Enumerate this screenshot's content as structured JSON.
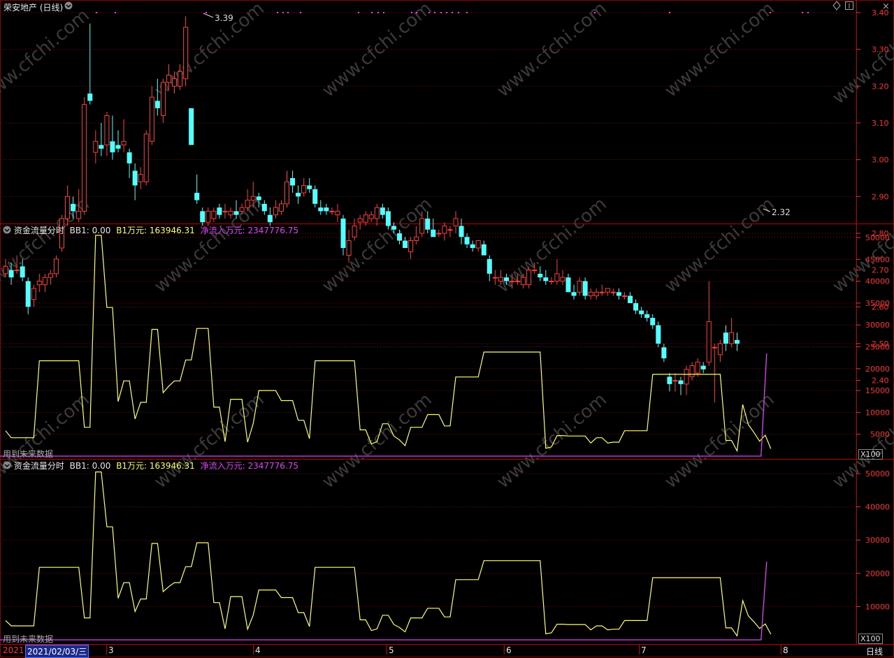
{
  "header": {
    "stock_title": "荣安地产 (日线)",
    "diamond_icon": "diamond-icon",
    "scroll_up_icon": "scroll-up-icon",
    "close_icon": "close-icon"
  },
  "price_panel": {
    "y_ticks": [
      "3.40",
      "3.30",
      "3.20",
      "3.10",
      "3.00",
      "2.90",
      "2.80",
      "2.70",
      "2.60",
      "2.50",
      "2.40"
    ],
    "high_label": "3.39",
    "low_label": "2.32",
    "watermark": "www.cfchi.com"
  },
  "indicator_panels": [
    {
      "title": "资金流量分时",
      "bb1_label": "BB1: 0.00",
      "b1_label": "B1万元: 163946.31",
      "net_label": "净流入万元: 2347776.75",
      "y_ticks": [
        "50000",
        "45000",
        "40000",
        "35000",
        "30000",
        "25000",
        "20000",
        "15000",
        "10000",
        "5000"
      ],
      "unit": "X100",
      "future_note": "用到未来数据"
    },
    {
      "title": "资金流量分时",
      "bb1_label": "BB1: 0.00",
      "b1_label": "B1万元: 163946.31",
      "net_label": "净流入万元: 2347776.75",
      "y_ticks": [
        "50000",
        "40000",
        "30000",
        "20000",
        "10000"
      ],
      "unit": "X100",
      "future_note": "用到未来数据"
    }
  ],
  "time_axis": {
    "year_label": "2021",
    "cursor_date": "2021/02/03/三",
    "month_labels": [
      "3",
      "4",
      "5",
      "6",
      "7",
      "8"
    ],
    "period_label": "日线"
  },
  "colors": {
    "up": "#ff3c3c",
    "down": "#54ffff",
    "grid": "#8b0000",
    "axis_text": "#ff3030",
    "b1_line": "#ffff66",
    "net_line": "#e040fb",
    "title_text": "#e8e8e8",
    "yellow_text": "#ffff66",
    "magenta_text": "#e040fb"
  },
  "chart_data": [
    {
      "type": "candlestick",
      "title": "荣安地产 (日线)",
      "ylim": [
        2.32,
        3.42
      ],
      "series": [
        {
          "ohlc": [
            [
              2.69,
              2.73,
              2.68,
              2.71
            ],
            [
              2.7,
              2.72,
              2.66,
              2.68
            ],
            [
              2.7,
              2.74,
              2.69,
              2.7
            ],
            [
              2.71,
              2.73,
              2.67,
              2.68
            ],
            [
              2.67,
              2.68,
              2.58,
              2.6
            ],
            [
              2.62,
              2.66,
              2.6,
              2.65
            ],
            [
              2.66,
              2.69,
              2.64,
              2.67
            ],
            [
              2.66,
              2.69,
              2.64,
              2.68
            ],
            [
              2.68,
              2.7,
              2.66,
              2.69
            ],
            [
              2.69,
              2.74,
              2.68,
              2.73
            ],
            [
              2.76,
              2.85,
              2.75,
              2.84
            ],
            [
              2.84,
              2.93,
              2.82,
              2.9
            ],
            [
              2.88,
              2.9,
              2.84,
              2.86
            ],
            [
              2.84,
              2.92,
              2.83,
              2.86
            ],
            [
              2.86,
              3.17,
              2.85,
              3.15
            ],
            [
              3.18,
              3.37,
              3.15,
              3.16
            ],
            [
              3.02,
              3.08,
              2.99,
              3.05
            ],
            [
              3.04,
              3.1,
              3.01,
              3.03
            ],
            [
              3.04,
              3.13,
              3.01,
              3.12
            ],
            [
              3.05,
              3.12,
              3.0,
              3.02
            ],
            [
              3.04,
              3.08,
              3.02,
              3.03
            ],
            [
              3.04,
              3.11,
              3.02,
              3.05
            ],
            [
              3.02,
              3.03,
              2.95,
              2.99
            ],
            [
              2.97,
              2.99,
              2.89,
              2.93
            ],
            [
              2.94,
              2.98,
              2.92,
              2.96
            ],
            [
              2.94,
              3.08,
              2.93,
              3.07
            ],
            [
              3.05,
              3.2,
              3.04,
              3.17
            ],
            [
              3.16,
              3.22,
              3.12,
              3.14
            ],
            [
              3.12,
              3.22,
              3.1,
              3.21
            ],
            [
              3.21,
              3.26,
              3.19,
              3.23
            ],
            [
              3.2,
              3.24,
              3.18,
              3.22
            ],
            [
              3.2,
              3.26,
              3.19,
              3.24
            ],
            [
              3.22,
              3.39,
              3.2,
              3.36
            ],
            [
              3.14,
              3.14,
              3.04,
              3.04
            ],
            [
              2.91,
              2.96,
              2.88,
              2.89
            ],
            [
              2.86,
              2.87,
              2.82,
              2.83
            ],
            [
              2.83,
              2.87,
              2.82,
              2.86
            ],
            [
              2.84,
              2.87,
              2.83,
              2.86
            ],
            [
              2.87,
              2.88,
              2.84,
              2.85
            ],
            [
              2.86,
              2.88,
              2.84,
              2.86
            ],
            [
              2.85,
              2.87,
              2.84,
              2.86
            ],
            [
              2.86,
              2.89,
              2.84,
              2.85
            ],
            [
              2.86,
              2.88,
              2.85,
              2.87
            ],
            [
              2.87,
              2.92,
              2.86,
              2.89
            ],
            [
              2.89,
              2.94,
              2.87,
              2.9
            ],
            [
              2.9,
              2.91,
              2.87,
              2.89
            ],
            [
              2.88,
              2.89,
              2.85,
              2.86
            ],
            [
              2.85,
              2.87,
              2.82,
              2.83
            ],
            [
              2.85,
              2.89,
              2.84,
              2.87
            ],
            [
              2.86,
              2.89,
              2.85,
              2.88
            ],
            [
              2.88,
              2.97,
              2.87,
              2.94
            ],
            [
              2.95,
              2.97,
              2.91,
              2.93
            ],
            [
              2.91,
              2.93,
              2.88,
              2.9
            ],
            [
              2.91,
              2.95,
              2.9,
              2.93
            ],
            [
              2.93,
              2.95,
              2.91,
              2.92
            ],
            [
              2.92,
              2.93,
              2.87,
              2.88
            ],
            [
              2.87,
              2.89,
              2.85,
              2.86
            ],
            [
              2.87,
              2.88,
              2.85,
              2.86
            ],
            [
              2.86,
              2.87,
              2.85,
              2.86
            ],
            [
              2.85,
              2.88,
              2.83,
              2.86
            ],
            [
              2.84,
              2.85,
              2.74,
              2.76
            ],
            [
              2.74,
              2.81,
              2.72,
              2.78
            ],
            [
              2.79,
              2.84,
              2.78,
              2.82
            ],
            [
              2.83,
              2.85,
              2.81,
              2.84
            ],
            [
              2.83,
              2.86,
              2.82,
              2.85
            ],
            [
              2.84,
              2.86,
              2.83,
              2.85
            ],
            [
              2.84,
              2.88,
              2.82,
              2.87
            ],
            [
              2.87,
              2.88,
              2.84,
              2.85
            ],
            [
              2.86,
              2.87,
              2.81,
              2.82
            ],
            [
              2.82,
              2.83,
              2.8,
              2.81
            ],
            [
              2.8,
              2.81,
              2.77,
              2.78
            ],
            [
              2.78,
              2.79,
              2.76,
              2.76
            ],
            [
              2.75,
              2.79,
              2.73,
              2.78
            ],
            [
              2.78,
              2.82,
              2.77,
              2.79
            ],
            [
              2.8,
              2.86,
              2.79,
              2.84
            ],
            [
              2.84,
              2.86,
              2.8,
              2.81
            ],
            [
              2.81,
              2.84,
              2.79,
              2.79
            ],
            [
              2.8,
              2.81,
              2.79,
              2.8
            ],
            [
              2.8,
              2.83,
              2.78,
              2.82
            ],
            [
              2.81,
              2.82,
              2.79,
              2.81
            ],
            [
              2.82,
              2.86,
              2.8,
              2.84
            ],
            [
              2.82,
              2.84,
              2.77,
              2.79
            ],
            [
              2.79,
              2.8,
              2.76,
              2.77
            ],
            [
              2.77,
              2.78,
              2.75,
              2.76
            ],
            [
              2.76,
              2.78,
              2.75,
              2.78
            ],
            [
              2.77,
              2.78,
              2.74,
              2.74
            ],
            [
              2.73,
              2.74,
              2.67,
              2.69
            ],
            [
              2.68,
              2.7,
              2.66,
              2.68
            ],
            [
              2.67,
              2.7,
              2.66,
              2.68
            ],
            [
              2.68,
              2.69,
              2.66,
              2.67
            ],
            [
              2.67,
              2.69,
              2.65,
              2.67
            ],
            [
              2.67,
              2.69,
              2.66,
              2.67
            ],
            [
              2.66,
              2.69,
              2.65,
              2.68
            ],
            [
              2.66,
              2.71,
              2.65,
              2.7
            ],
            [
              2.7,
              2.72,
              2.69,
              2.7
            ],
            [
              2.69,
              2.71,
              2.67,
              2.68
            ],
            [
              2.68,
              2.7,
              2.66,
              2.67
            ],
            [
              2.67,
              2.68,
              2.66,
              2.67
            ],
            [
              2.67,
              2.73,
              2.66,
              2.69
            ],
            [
              2.67,
              2.7,
              2.66,
              2.68
            ],
            [
              2.68,
              2.69,
              2.64,
              2.64
            ],
            [
              2.64,
              2.66,
              2.62,
              2.63
            ],
            [
              2.64,
              2.68,
              2.63,
              2.67
            ],
            [
              2.67,
              2.68,
              2.62,
              2.63
            ],
            [
              2.63,
              2.65,
              2.62,
              2.64
            ],
            [
              2.63,
              2.65,
              2.62,
              2.64
            ],
            [
              2.64,
              2.66,
              2.63,
              2.64
            ],
            [
              2.64,
              2.65,
              2.63,
              2.65
            ],
            [
              2.64,
              2.65,
              2.63,
              2.64
            ],
            [
              2.64,
              2.65,
              2.62,
              2.63
            ],
            [
              2.63,
              2.64,
              2.62,
              2.63
            ],
            [
              2.63,
              2.64,
              2.61,
              2.61
            ],
            [
              2.61,
              2.62,
              2.58,
              2.59
            ],
            [
              2.59,
              2.6,
              2.57,
              2.58
            ],
            [
              2.58,
              2.59,
              2.56,
              2.57
            ],
            [
              2.57,
              2.58,
              2.54,
              2.55
            ],
            [
              2.55,
              2.56,
              2.49,
              2.5
            ],
            [
              2.49,
              2.5,
              2.45,
              2.46
            ],
            [
              2.41,
              2.42,
              2.37,
              2.39
            ],
            [
              2.4,
              2.42,
              2.37,
              2.4
            ],
            [
              2.4,
              2.41,
              2.36,
              2.39
            ],
            [
              2.39,
              2.44,
              2.36,
              2.43
            ],
            [
              2.41,
              2.45,
              2.4,
              2.44
            ],
            [
              2.42,
              2.46,
              2.41,
              2.45
            ],
            [
              2.44,
              2.45,
              2.42,
              2.43
            ],
            [
              2.45,
              2.67,
              2.44,
              2.56
            ],
            [
              2.49,
              2.5,
              2.34,
              2.49
            ],
            [
              2.47,
              2.51,
              2.45,
              2.5
            ],
            [
              2.53,
              2.55,
              2.48,
              2.5
            ],
            [
              2.5,
              2.57,
              2.49,
              2.53
            ],
            [
              2.51,
              2.53,
              2.48,
              2.5
            ]
          ]
        }
      ]
    },
    {
      "type": "line",
      "title": "资金流量分时",
      "ylim": [
        0,
        50000
      ],
      "series": [
        {
          "name": "B1万元",
          "color": "#ffff66",
          "values": [
            5800,
            4200,
            4200,
            4200,
            4200,
            4200,
            21800,
            21800,
            21800,
            21800,
            21800,
            21800,
            21800,
            21800,
            6600,
            6600,
            50500,
            50500,
            34000,
            34000,
            12500,
            17200,
            17200,
            8500,
            12300,
            12300,
            29000,
            29000,
            14500,
            16000,
            17200,
            17200,
            22000,
            22000,
            29200,
            29200,
            29200,
            11200,
            11200,
            3300,
            13000,
            13000,
            13000,
            3200,
            7400,
            15000,
            15000,
            15000,
            15000,
            12700,
            12700,
            12700,
            8200,
            8200,
            4000,
            21800,
            21800,
            21800,
            21800,
            21800,
            21800,
            21800,
            21800,
            6000,
            6000,
            2800,
            3300,
            7400,
            7400,
            4600,
            3700,
            2400,
            6600,
            6600,
            6600,
            9500,
            9500,
            9500,
            6900,
            6900,
            18100,
            18100,
            18100,
            18100,
            18100,
            23800,
            23800,
            23800,
            23800,
            23800,
            23800,
            23800,
            23800,
            23800,
            23800,
            23800,
            1800,
            2100,
            4700,
            4700,
            4600,
            4600,
            4600,
            4600,
            3000,
            4200,
            4200,
            3000,
            3200,
            3200,
            5800,
            5800,
            5800,
            5800,
            5800,
            18700,
            18700,
            18700,
            18700,
            18700,
            18700,
            18700,
            18700,
            18700,
            18700,
            18700,
            18700,
            18700,
            3600,
            3600,
            1200,
            11800,
            7200,
            5400,
            3400,
            4800,
            1700
          ]
        },
        {
          "name": "净流入万元",
          "color": "#e040fb",
          "values_note": "flat at 0, rises at last bar",
          "values": [
            0,
            23500
          ]
        }
      ]
    }
  ]
}
